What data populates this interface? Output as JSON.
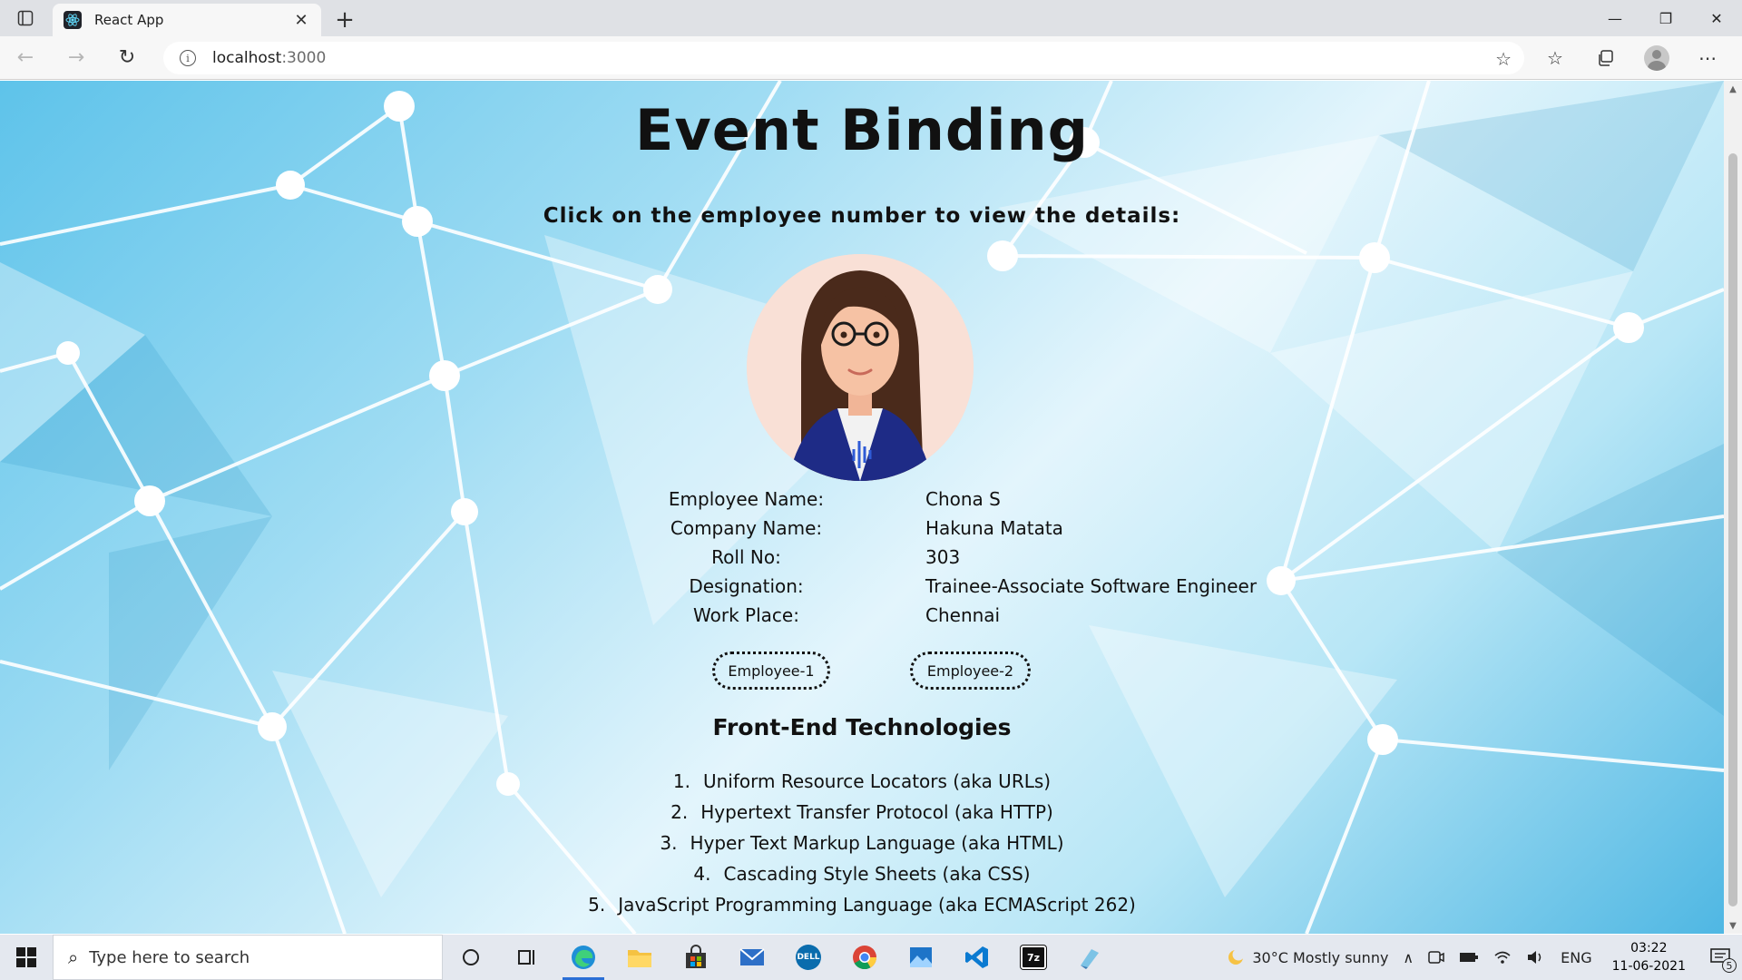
{
  "browser": {
    "tab_title": "React App",
    "tab_close": "✕",
    "new_tab": "+",
    "url_host": "localhost",
    "url_port": ":3000",
    "window_controls": {
      "minimize": "—",
      "maximize": "❐",
      "close": "✕"
    }
  },
  "page": {
    "title": "Event Binding",
    "subtitle": "Click on the employee number to view the details:",
    "employee": {
      "name_label": "Employee Name:",
      "name": "Chona S",
      "company_label": "Company Name:",
      "company": "Hakuna Matata",
      "roll_label": "Roll No:",
      "roll": "303",
      "designation_label": "Designation:",
      "designation": "Trainee-Associate Software Engineer",
      "workplace_label": "Work Place:",
      "workplace": "Chennai"
    },
    "buttons": {
      "employee1": "Employee-1",
      "employee2": "Employee-2"
    },
    "tech_title": "Front-End Technologies",
    "tech_list": [
      {
        "num": "1.",
        "text": "Uniform Resource Locators (aka URLs)"
      },
      {
        "num": "2.",
        "text": "Hypertext Transfer Protocol (aka HTTP)"
      },
      {
        "num": "3.",
        "text": "Hyper Text Markup Language (aka HTML)"
      },
      {
        "num": "4.",
        "text": "Cascading Style Sheets (aka CSS)"
      },
      {
        "num": "5.",
        "text": "JavaScript Programming Language (aka ECMAScript 262)"
      }
    ]
  },
  "taskbar": {
    "search_placeholder": "Type here to search",
    "weather": "30°C  Mostly sunny",
    "language": "ENG",
    "time": "03:22",
    "date": "11-06-2021",
    "notification_count": "5"
  },
  "colors": {
    "accent": "#2b6fd6",
    "taskbar_bg": "#e4e8ef",
    "text": "#111111"
  }
}
